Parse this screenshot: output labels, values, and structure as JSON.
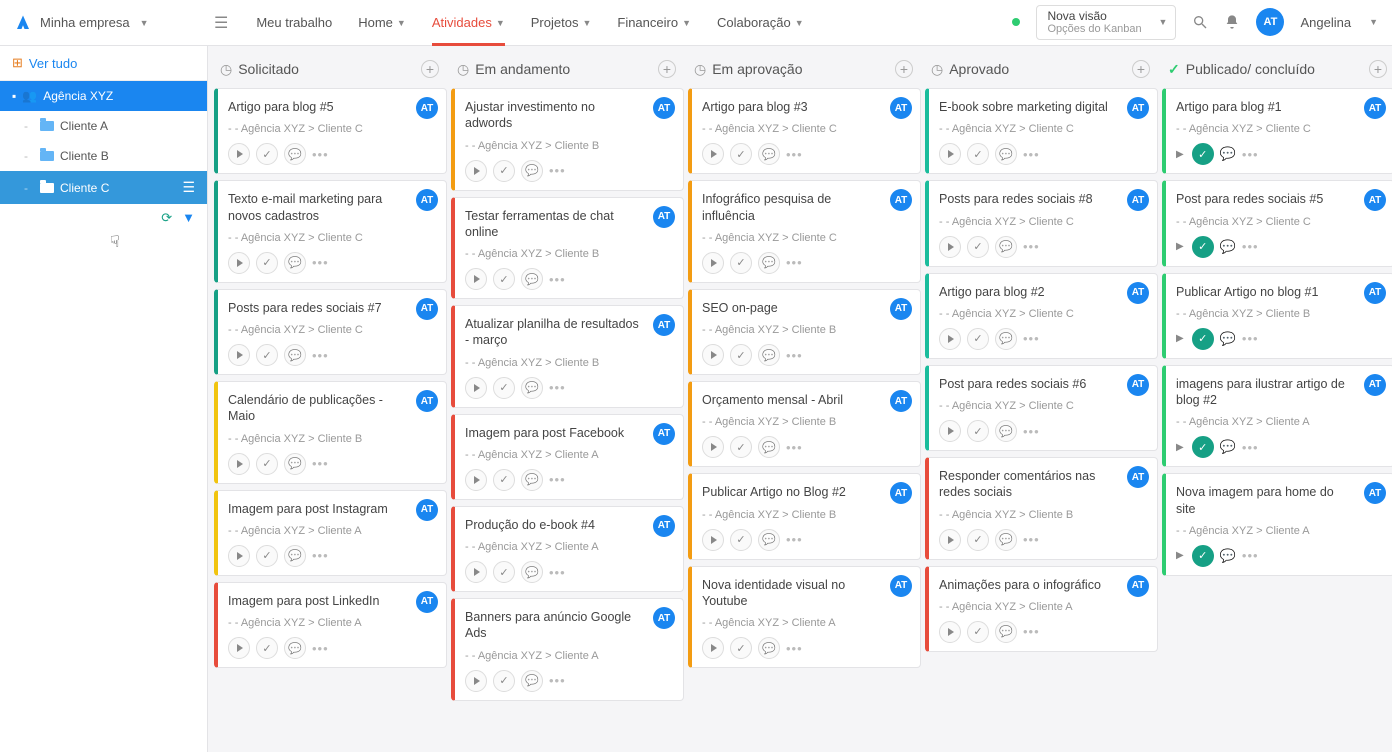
{
  "brand": "Minha empresa",
  "nav": [
    {
      "label": "Meu trabalho",
      "caret": false,
      "active": false
    },
    {
      "label": "Home",
      "caret": true,
      "active": false
    },
    {
      "label": "Atividades",
      "caret": true,
      "active": true
    },
    {
      "label": "Projetos",
      "caret": true,
      "active": false
    },
    {
      "label": "Financeiro",
      "caret": true,
      "active": false
    },
    {
      "label": "Colaboração",
      "caret": true,
      "active": false
    }
  ],
  "vision": {
    "title": "Nova visão",
    "sub": "Opções do Kanban"
  },
  "user": {
    "initials": "AT",
    "name": "Angelina"
  },
  "sidebar": {
    "view_all": "Ver tudo",
    "root": "Agência XYZ",
    "items": [
      {
        "label": "Cliente A",
        "active": false
      },
      {
        "label": "Cliente B",
        "active": false
      },
      {
        "label": "Cliente C",
        "active": true
      }
    ]
  },
  "columns": [
    {
      "title": "Solicitado",
      "icon": "clock",
      "cards": [
        {
          "title": "Artigo para blog #5",
          "path": "- - Agência XYZ > Cliente C",
          "color": "teal",
          "avatar": "AT"
        },
        {
          "title": "Texto e-mail marketing para novos cadastros",
          "path": "- - Agência XYZ > Cliente C",
          "color": "teal",
          "avatar": "AT"
        },
        {
          "title": "Posts para redes sociais #7",
          "path": "- - Agência XYZ > Cliente C",
          "color": "teal",
          "avatar": "AT"
        },
        {
          "title": "Calendário de publicações - Maio",
          "path": "- - Agência XYZ > Cliente B",
          "color": "yellow",
          "avatar": "AT"
        },
        {
          "title": "Imagem para post Instagram",
          "path": "- - Agência XYZ > Cliente A",
          "color": "yellow",
          "avatar": "AT"
        },
        {
          "title": "Imagem para post LinkedIn",
          "path": "- - Agência XYZ > Cliente A",
          "color": "red",
          "avatar": "AT"
        }
      ]
    },
    {
      "title": "Em andamento",
      "icon": "clock",
      "cards": [
        {
          "title": "Ajustar investimento no adwords",
          "path": "- - Agência XYZ > Cliente B",
          "color": "orange",
          "avatar": "AT"
        },
        {
          "title": "Testar ferramentas de chat online",
          "path": "- - Agência XYZ > Cliente B",
          "color": "red",
          "avatar": "AT"
        },
        {
          "title": "Atualizar planilha de resultados - março",
          "path": "- - Agência XYZ > Cliente B",
          "color": "red",
          "avatar": "AT"
        },
        {
          "title": "Imagem para post Facebook",
          "path": "- - Agência XYZ > Cliente A",
          "color": "red",
          "avatar": "AT"
        },
        {
          "title": "Produção do e-book #4",
          "path": "- - Agência XYZ > Cliente A",
          "color": "red",
          "avatar": "AT"
        },
        {
          "title": "Banners para anúncio Google Ads",
          "path": "- - Agência XYZ > Cliente A",
          "color": "red",
          "avatar": "AT"
        }
      ]
    },
    {
      "title": "Em aprovação",
      "icon": "clock",
      "cards": [
        {
          "title": "Artigo para blog #3",
          "path": "- - Agência XYZ > Cliente C",
          "color": "orange",
          "avatar": "AT"
        },
        {
          "title": "Infográfico pesquisa de influência",
          "path": "- - Agência XYZ > Cliente C",
          "color": "orange",
          "avatar": "AT"
        },
        {
          "title": "SEO on-page",
          "path": "- - Agência XYZ > Cliente B",
          "color": "orange",
          "avatar": "AT"
        },
        {
          "title": "Orçamento mensal - Abril",
          "path": "- - Agência XYZ > Cliente B",
          "color": "orange",
          "avatar": "AT"
        },
        {
          "title": "Publicar Artigo no Blog #2",
          "path": "- - Agência XYZ > Cliente B",
          "color": "orange",
          "avatar": "AT"
        },
        {
          "title": "Nova identidade visual no Youtube",
          "path": "- - Agência XYZ > Cliente A",
          "color": "orange",
          "avatar": "AT"
        }
      ]
    },
    {
      "title": "Aprovado",
      "icon": "clock",
      "cards": [
        {
          "title": "E-book sobre marketing digital",
          "path": "- - Agência XYZ > Cliente C",
          "color": "cyan",
          "avatar": "AT"
        },
        {
          "title": "Posts para redes sociais #8",
          "path": "- - Agência XYZ > Cliente C",
          "color": "cyan",
          "avatar": "AT"
        },
        {
          "title": "Artigo para blog #2",
          "path": "- - Agência XYZ > Cliente C",
          "color": "cyan",
          "avatar": "AT"
        },
        {
          "title": "Post para redes sociais #6",
          "path": "- - Agência XYZ > Cliente C",
          "color": "cyan",
          "avatar": "AT"
        },
        {
          "title": "Responder comentários nas redes sociais",
          "path": "- - Agência XYZ > Cliente B",
          "color": "red",
          "avatar": "AT"
        },
        {
          "title": "Animações para o infográfico",
          "path": "- - Agência XYZ > Cliente A",
          "color": "red",
          "avatar": "AT"
        }
      ]
    },
    {
      "title": "Publicado/ concluído",
      "icon": "check",
      "cards": [
        {
          "title": "Artigo para blog #1",
          "path": "- - Agência XYZ > Cliente C",
          "color": "green",
          "avatar": "AT",
          "done": true
        },
        {
          "title": "Post para redes sociais #5",
          "path": "- - Agência XYZ > Cliente C",
          "color": "green",
          "avatar": "AT",
          "done": true
        },
        {
          "title": "Publicar Artigo no blog #1",
          "path": "- - Agência XYZ > Cliente B",
          "color": "green",
          "avatar": "AT",
          "done": true
        },
        {
          "title": "imagens para ilustrar artigo de blog #2",
          "path": "- - Agência XYZ > Cliente A",
          "color": "green",
          "avatar": "AT",
          "done": true
        },
        {
          "title": "Nova imagem para home do site",
          "path": "- - Agência XYZ > Cliente A",
          "color": "green",
          "avatar": "AT",
          "done": true
        }
      ]
    }
  ]
}
